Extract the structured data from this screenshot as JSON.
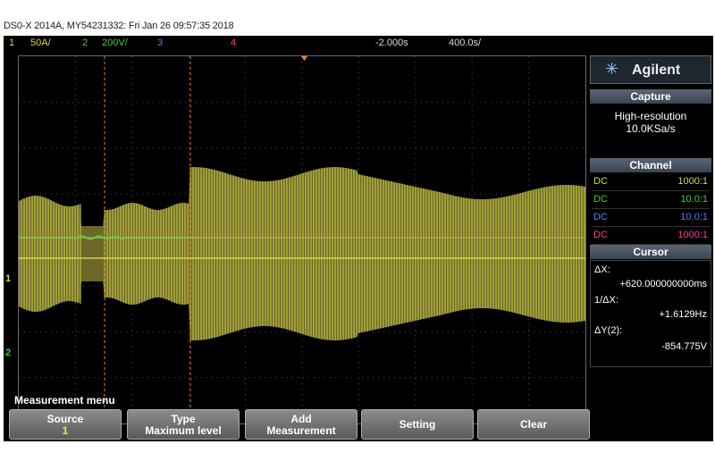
{
  "header": {
    "title": "DS0-X 2014A, MY54231332: Fri Jan 26 09:57:35 2018"
  },
  "topbar": {
    "ch1_num": "1",
    "ch1_scale": "50A/",
    "ch2_num": "2",
    "ch2_scale": "200V/",
    "ch3_num": "3",
    "ch4_num": "4",
    "time_delay": "-2.000s",
    "time_scale": "400.0s/"
  },
  "brand": {
    "name": "Agilent"
  },
  "capture": {
    "title": "Capture",
    "mode": "High-resolution",
    "rate": "10.0KSa/s"
  },
  "channel": {
    "title": "Channel",
    "rows": [
      {
        "coupling": "DC",
        "probe": "1000:1",
        "color": "#d8d44a"
      },
      {
        "coupling": "DC",
        "probe": "10.0:1",
        "color": "#3ecf3e"
      },
      {
        "coupling": "DC",
        "probe": "10.0:1",
        "color": "#5a78ff"
      },
      {
        "coupling": "DC",
        "probe": "1000:1",
        "color": "#ff3c9c"
      }
    ]
  },
  "cursor": {
    "title": "Cursor",
    "dx_label": "ΔX:",
    "dx_value": "+620.000000000ms",
    "inv_label": "1/ΔX:",
    "inv_value": "+1.6129Hz",
    "dy_label": "ΔY(2):",
    "dy_value": "-854.775V"
  },
  "markers": {
    "ch1": "1",
    "ch2": "2"
  },
  "measurement": {
    "title": "Measurement menu",
    "softkeys": [
      {
        "line1": "Source",
        "line2": "1"
      },
      {
        "line1": "Type",
        "line2": "Maximum level"
      },
      {
        "line1": "Add",
        "line2": "Measurement"
      },
      {
        "line1": "Setting",
        "line2": ""
      },
      {
        "line1": "Clear",
        "line2": ""
      }
    ]
  }
}
